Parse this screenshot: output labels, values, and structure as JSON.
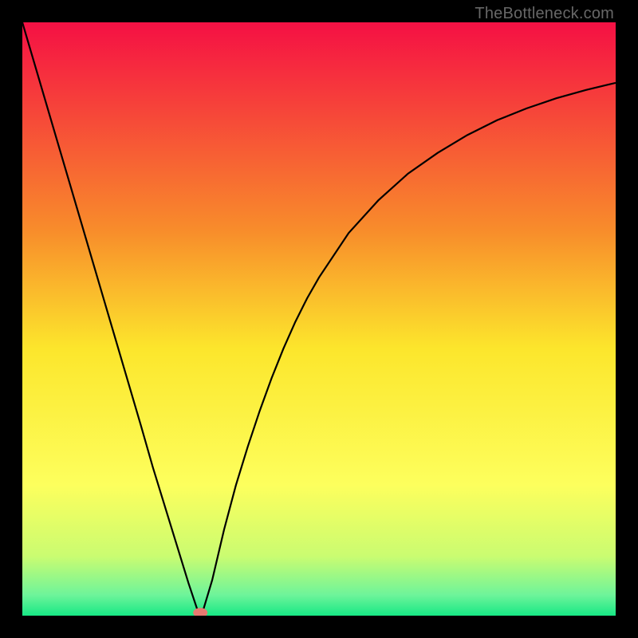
{
  "watermark": "TheBottleneck.com",
  "chart_data": {
    "type": "line",
    "title": "",
    "xlabel": "",
    "ylabel": "",
    "xlim": [
      0,
      100
    ],
    "ylim": [
      0,
      100
    ],
    "grid": false,
    "series": [
      {
        "name": "curve",
        "x": [
          0,
          2,
          4,
          6,
          8,
          10,
          12,
          14,
          16,
          18,
          20,
          22,
          24,
          26,
          28,
          29.5,
          30.5,
          32,
          34,
          36,
          38,
          40,
          42,
          44,
          46,
          48,
          50,
          55,
          60,
          65,
          70,
          75,
          80,
          85,
          90,
          95,
          100
        ],
        "y": [
          100,
          93.2,
          86.4,
          79.6,
          72.8,
          66,
          59.2,
          52.4,
          45.6,
          38.8,
          32,
          25,
          18.5,
          12,
          5.5,
          1,
          1,
          6,
          14.5,
          22,
          28.5,
          34.5,
          40,
          45,
          49.5,
          53.5,
          57,
          64.5,
          70,
          74.5,
          78,
          81,
          83.5,
          85.5,
          87.2,
          88.6,
          89.8
        ]
      }
    ],
    "marker": {
      "x": 30,
      "y": 0.5,
      "color": "#e77a71"
    },
    "gradient_stops": [
      {
        "offset": 0,
        "color": "#f51044"
      },
      {
        "offset": 0.35,
        "color": "#f88c2b"
      },
      {
        "offset": 0.55,
        "color": "#fce62c"
      },
      {
        "offset": 0.78,
        "color": "#fdff5d"
      },
      {
        "offset": 0.9,
        "color": "#cafc71"
      },
      {
        "offset": 0.965,
        "color": "#6ef49a"
      },
      {
        "offset": 1.0,
        "color": "#17e885"
      }
    ]
  }
}
